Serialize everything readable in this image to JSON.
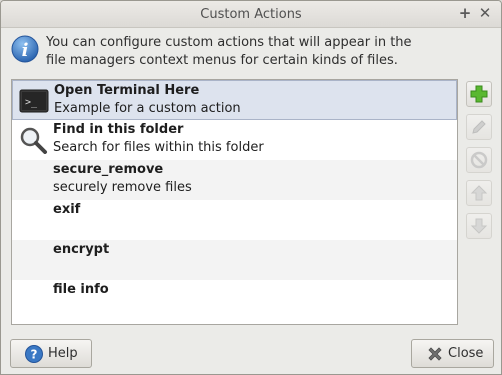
{
  "window": {
    "title": "Custom Actions"
  },
  "info": {
    "icon": "info-icon",
    "line1": "You can configure custom actions that will appear in the",
    "line2": "file managers context menus for certain kinds of files."
  },
  "actions": [
    {
      "name": "Open Terminal Here",
      "description": "Example for a custom action",
      "icon": "terminal-icon",
      "selected": true
    },
    {
      "name": "Find in this folder",
      "description": "Search for files within this folder",
      "icon": "magnifier-icon",
      "selected": false
    },
    {
      "name": "secure_remove",
      "description": "securely remove files",
      "icon": "",
      "selected": false
    },
    {
      "name": "exif",
      "description": "",
      "icon": "",
      "selected": false
    },
    {
      "name": "encrypt",
      "description": "",
      "icon": "",
      "selected": false
    },
    {
      "name": "file info",
      "description": "",
      "icon": "",
      "selected": false
    }
  ],
  "side_buttons": [
    {
      "name": "add-action-button",
      "icon": "plus-icon",
      "enabled": true
    },
    {
      "name": "edit-action-button",
      "icon": "pencil-icon",
      "enabled": false
    },
    {
      "name": "delete-action-button",
      "icon": "prohibit-icon",
      "enabled": false
    },
    {
      "name": "move-up-button",
      "icon": "arrow-up-icon",
      "enabled": false
    },
    {
      "name": "move-down-button",
      "icon": "arrow-down-icon",
      "enabled": false
    }
  ],
  "buttons": {
    "help_label": "Help",
    "close_label": "Close"
  },
  "colors": {
    "selection": "#dde3ee",
    "info_blue": "#3a78c4",
    "add_green": "#5ab830"
  }
}
